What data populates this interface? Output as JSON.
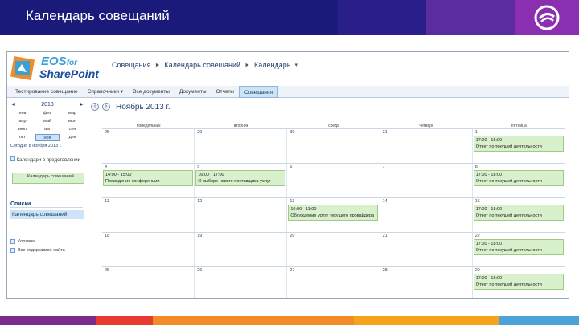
{
  "slide": {
    "title": "Календарь совещаний",
    "header_color": "#1a1a7a",
    "bands": [
      "#1a1a7a",
      "#2a1f8a",
      "#5b2ca0",
      "#8a2fb0"
    ],
    "bottom_bar": [
      "#7b2d8e",
      "#e63b2e",
      "#f28c28",
      "#f7a21b",
      "#4ba3d9"
    ]
  },
  "app": {
    "logo_top": "EOS",
    "logo_for": "for",
    "logo_bottom": "SharePoint",
    "breadcrumbs": [
      "Совещания",
      "Календарь совещаний",
      "Календарь"
    ],
    "tabs": [
      {
        "label": "Тестирование совещание",
        "active": false
      },
      {
        "label": "Справочники ▾",
        "active": false
      },
      {
        "label": "Все документы",
        "active": false
      },
      {
        "label": "Документы",
        "active": false
      },
      {
        "label": "Отчеты",
        "active": false
      },
      {
        "label": "Совещания",
        "active": true
      }
    ]
  },
  "leftnav": {
    "mini_year": "2013",
    "months": [
      "янв",
      "фев",
      "мар",
      "апр",
      "май",
      "июн",
      "июл",
      "авг",
      "сен",
      "окт",
      "ноя",
      "дек"
    ],
    "selected_month": "ноя",
    "today": "Сегодня 8 ноября 2013 г.",
    "group": "Календари в представлении",
    "calendar_item": "Календарь совещаний",
    "lists_head": "Списки",
    "list_item": "Календарь совещаний",
    "bottom_links": [
      "Корзина",
      "Все содержимое сайта"
    ]
  },
  "calendar": {
    "month_title": "Ноябрь 2013 г.",
    "weekdays": [
      "понедельник",
      "вторник",
      "среда",
      "четверг",
      "пятница"
    ],
    "weeks": [
      {
        "days": [
          {
            "num": "25",
            "event": null
          },
          {
            "num": "29",
            "event": null
          },
          {
            "num": "30",
            "event": null
          },
          {
            "num": "31",
            "event": null
          },
          {
            "num": "1",
            "event": {
              "time": "17:00 - 18:00",
              "title": "Отчет по текущей деятельности"
            }
          }
        ]
      },
      {
        "days": [
          {
            "num": "4",
            "event": {
              "time": "14:00 - 15:00",
              "title": "Проведение конференции"
            }
          },
          {
            "num": "5",
            "event": {
              "time": "16:00 - 17:00",
              "title": "О выборе нового поставщика услуг"
            }
          },
          {
            "num": "6",
            "event": null
          },
          {
            "num": "7",
            "event": null
          },
          {
            "num": "8",
            "event": {
              "time": "17:00 - 18:00",
              "title": "Отчет по текущей деятельности"
            }
          }
        ]
      },
      {
        "days": [
          {
            "num": "11",
            "event": null
          },
          {
            "num": "12",
            "event": null
          },
          {
            "num": "13",
            "event": {
              "time": "10:00 - 11:00",
              "title": "Обсуждение услуг текущего провайдера"
            }
          },
          {
            "num": "14",
            "event": null
          },
          {
            "num": "15",
            "event": {
              "time": "17:00 - 18:00",
              "title": "Отчет по текущей деятельности"
            }
          }
        ]
      },
      {
        "days": [
          {
            "num": "18",
            "event": null
          },
          {
            "num": "19",
            "event": null
          },
          {
            "num": "20",
            "event": null
          },
          {
            "num": "21",
            "event": null
          },
          {
            "num": "22",
            "event": {
              "time": "17:00 - 18:00",
              "title": "Отчет по текущей деятельности"
            }
          }
        ]
      },
      {
        "days": [
          {
            "num": "25",
            "event": null
          },
          {
            "num": "26",
            "event": null
          },
          {
            "num": "27",
            "event": null
          },
          {
            "num": "28",
            "event": null
          },
          {
            "num": "29",
            "event": {
              "time": "17:00 - 18:00",
              "title": "Отчет по текущей деятельности"
            }
          }
        ]
      }
    ]
  }
}
